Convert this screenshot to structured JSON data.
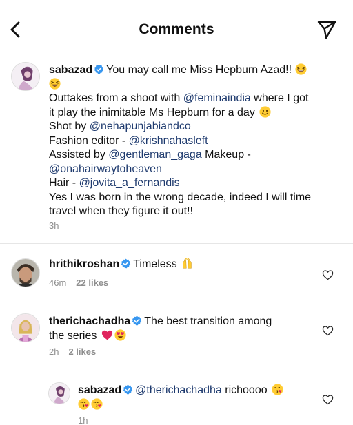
{
  "header": {
    "title": "Comments",
    "back_icon": "chevron-left-icon",
    "send_icon": "paper-plane-icon"
  },
  "caption": {
    "username": "sabazad",
    "line1": "You may call me Miss Hepburn Azad!!",
    "line3_a": "Outtakes from a shoot with ",
    "line3_mention": "@feminaindia",
    "line3_b": " where I got",
    "line4": "it play the inimitable Ms Hepburn for a day",
    "line5_a": "Shot by ",
    "line5_mention": "@nehapunjabiandco",
    "line6_a": "Fashion editor - ",
    "line6_mention": "@krishnahasleft",
    "line7_a": "Assisted by ",
    "line7_mention": "@gentleman_gaga",
    "line7_b": " Makeup -",
    "line8_mention": "@onahairwaytoheaven",
    "line9_a": "Hair - ",
    "line9_mention": "@jovita_a_fernandis",
    "line10": "Yes I was born in the wrong decade, indeed I will time",
    "line11": "travel when they figure it out!!",
    "time": "3h"
  },
  "comments": [
    {
      "username": "hrithikroshan",
      "text": "Timeless",
      "time": "46m",
      "likes": "22 likes"
    },
    {
      "username": "therichachadha",
      "text_line1": "The best transition among",
      "text_line2": "the series",
      "time": "2h",
      "likes": "2 likes"
    }
  ],
  "reply": {
    "username": "sabazad",
    "mention": "@therichachadha",
    "text": " richoooo",
    "time": "1h"
  },
  "colors": {
    "verified": "#3897f0",
    "mention": "#1e3a6e",
    "meta": "#8e8e8e",
    "heart_red": "#e0245e"
  }
}
